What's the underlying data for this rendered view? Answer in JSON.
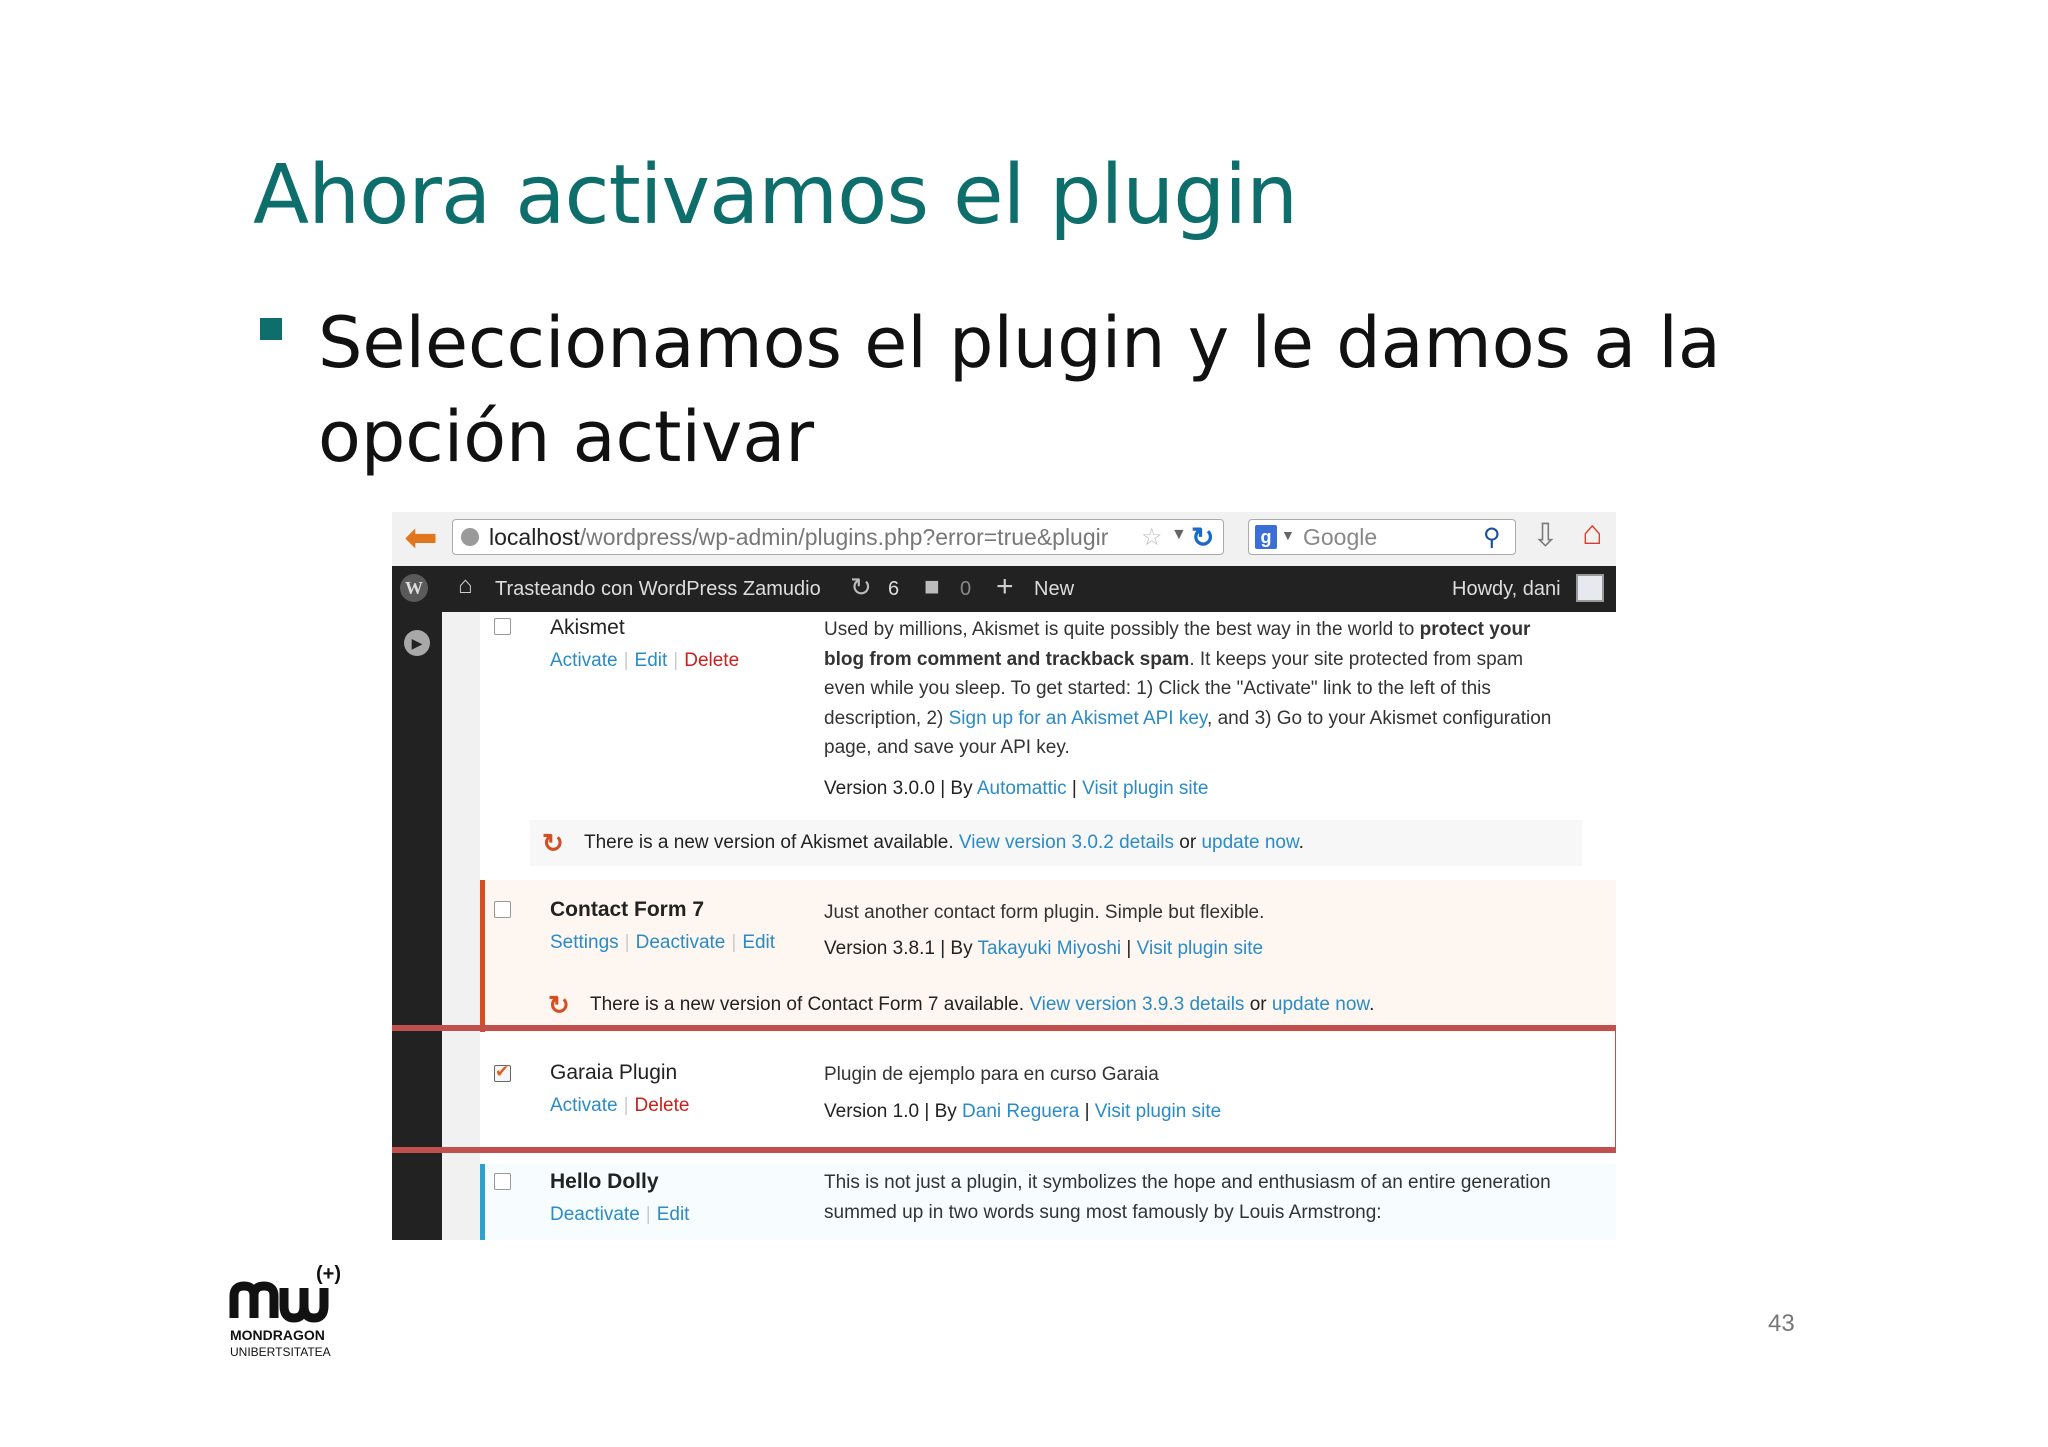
{
  "slide": {
    "title": "Ahora activamos el plugin",
    "bullet": "Seleccionamos el plugin y le damos a la opción activar",
    "page_number": "43"
  },
  "logo": {
    "name": "MONDRAGON",
    "sub": "UNIBERTSITATEA",
    "mark": "(+)"
  },
  "browser": {
    "url_host": "localhost",
    "url_path": "/wordpress/wp-admin/plugins.php?error=true&plugir",
    "search_placeholder": "Google"
  },
  "admin_bar": {
    "site_name": "Trasteando con WordPress Zamudio",
    "updates_count": "6",
    "comments_count": "0",
    "new_label": "New",
    "howdy": "Howdy, dani"
  },
  "plugins": [
    {
      "name": "Akismet",
      "actions": [
        "Activate",
        "Edit",
        "Delete"
      ],
      "description_parts": [
        "Used by millions, Akismet is quite possibly the best way in the world to ",
        "protect your blog from comment and trackback spam",
        ". It keeps your site protected from spam even while you sleep. To get started: 1) Click the \"Activate\" link to the left of this description, 2) ",
        "Sign up for an Akismet API key",
        ", and 3) Go to your Akismet configuration page, and save your API key."
      ],
      "version": "Version 3.0.0",
      "by_label": "By",
      "author": "Automattic",
      "site_link": "Visit plugin site",
      "update_notice": [
        "There is a new version of Akismet available. ",
        "View version 3.0.2 details",
        " or ",
        "update now",
        "."
      ]
    },
    {
      "name": "Contact Form 7",
      "actions": [
        "Settings",
        "Deactivate",
        "Edit"
      ],
      "description": "Just another contact form plugin. Simple but flexible.",
      "version": "Version 3.8.1",
      "by_label": "By",
      "author": "Takayuki Miyoshi",
      "site_link": "Visit plugin site",
      "update_notice": [
        "There is a new version of Contact Form 7 available. ",
        "View version 3.9.3 details",
        " or ",
        "update now",
        "."
      ]
    },
    {
      "name": "Garaia Plugin",
      "actions": [
        "Activate",
        "Delete"
      ],
      "description": "Plugin de ejemplo para en curso Garaia",
      "version": "Version 1.0",
      "by_label": "By",
      "author": "Dani Reguera",
      "site_link": "Visit plugin site",
      "checked": true
    },
    {
      "name": "Hello Dolly",
      "actions": [
        "Deactivate",
        "Edit"
      ],
      "description": "This is not just a plugin, it symbolizes the hope and enthusiasm of an entire generation summed up in two words sung most famously by Louis Armstrong:"
    }
  ],
  "colors": {
    "title_teal": "#0d6e6b",
    "highlight_red": "#c0504d",
    "link_blue": "#2a8bc6",
    "delete_red": "#c8201a"
  },
  "icons": [
    "back-arrow-icon",
    "globe-icon",
    "star-icon",
    "reload-icon",
    "google-icon",
    "magnifier-icon",
    "download-icon",
    "home-icon",
    "wordpress-icon",
    "house-icon",
    "updates-icon",
    "comment-icon",
    "plus-icon",
    "avatar",
    "play-icon",
    "update-notice-icon"
  ]
}
